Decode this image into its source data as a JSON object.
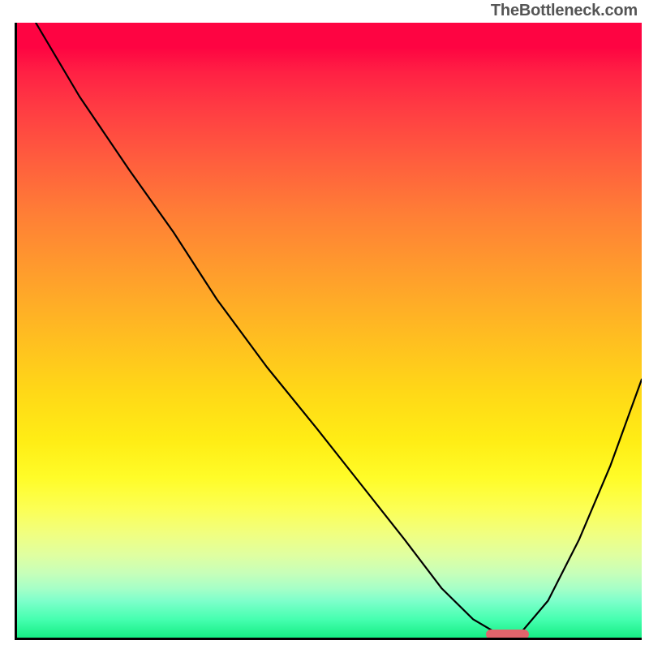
{
  "watermark": "TheBottleneck.com",
  "chart_data": {
    "type": "line",
    "title": "",
    "xlabel": "",
    "ylabel": "",
    "xlim": [
      0,
      100
    ],
    "ylim": [
      0,
      100
    ],
    "grid": false,
    "background": "rainbow-vertical-gradient",
    "series": [
      {
        "name": "bottleneck-curve",
        "x": [
          3,
          10,
          18,
          25,
          32,
          40,
          48,
          55,
          62,
          68,
          73,
          78,
          80,
          85,
          90,
          95,
          100
        ],
        "y": [
          100,
          88,
          76,
          66,
          55,
          44,
          34,
          25,
          16,
          8,
          3,
          0,
          0,
          6,
          16,
          28,
          42
        ],
        "color": "#000000",
        "stroke_width": 2
      }
    ],
    "annotations": [
      {
        "type": "marker",
        "shape": "rounded-bar",
        "x_range": [
          75,
          82
        ],
        "y": 0.5,
        "color": "#e1656c"
      }
    ]
  }
}
